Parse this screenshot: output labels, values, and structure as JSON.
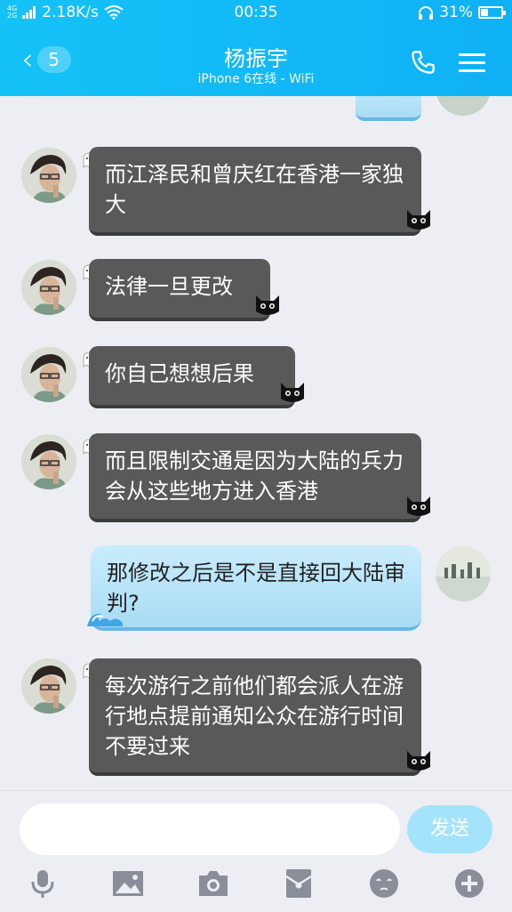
{
  "status_bar": {
    "network_top": "4G",
    "network_bottom": "2G",
    "speed": "2.18K/s",
    "time": "00:35",
    "battery": "31%"
  },
  "header": {
    "back_badge": "5",
    "title": "杨振宇",
    "subtitle": "iPhone 6在线 - WiFi"
  },
  "messages": [
    {
      "from": "other",
      "text": "而江泽民和曾庆红在香港一家独大"
    },
    {
      "from": "other",
      "text": "法律一旦更改"
    },
    {
      "from": "other",
      "text": "你自己想想后果"
    },
    {
      "from": "other",
      "text": "而且限制交通是因为大陆的兵力会从这些地方进入香港"
    },
    {
      "from": "me",
      "text": "那修改之后是不是直接回大陆审判?"
    },
    {
      "from": "other",
      "text": "每次游行之前他们都会派人在游行地点提前通知公众在游行时间不要过来"
    }
  ],
  "input": {
    "placeholder": "",
    "send_label": "发送"
  },
  "toolbar_icons": [
    "mic-icon",
    "image-icon",
    "camera-icon",
    "red-packet-icon",
    "emoji-icon",
    "plus-icon"
  ],
  "colors": {
    "header": "#15c2f7",
    "other_bubble": "#595959",
    "my_bubble": "#b7e3f8",
    "send_button": "#a3e4fa",
    "icon_gray": "#8a8e98"
  }
}
